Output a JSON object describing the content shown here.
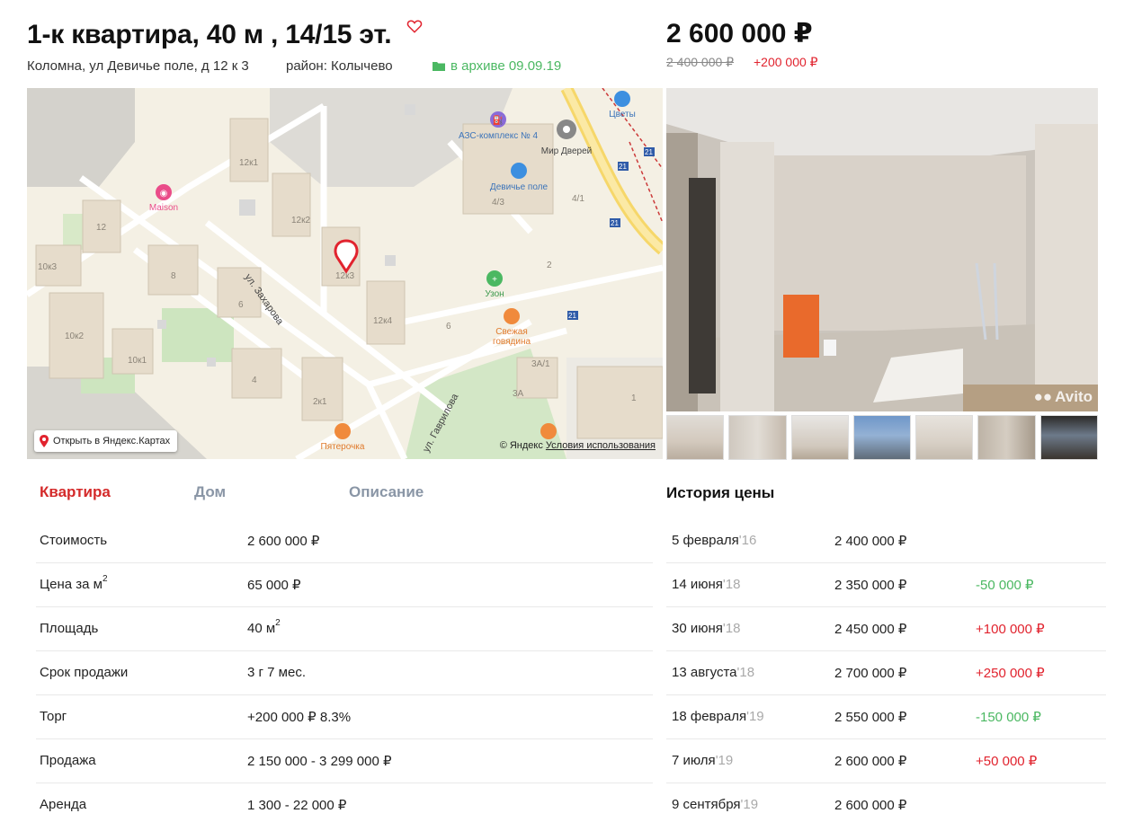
{
  "listing": {
    "title": "1-к квартира, 40 м , 14/15 эт.",
    "address": "Коломна, ул Девичье поле, д 12 к 3",
    "district": "район: Колычево",
    "archive_label": "в архиве 09.09.19",
    "favorite_icon": "heart-icon",
    "price": "2 600 000 ₽",
    "old_price": "2 400 000 ₽",
    "price_change": "+200 000 ₽"
  },
  "map": {
    "open_link": "Открыть в Яндекс.Картах",
    "copyright": "© Яндекс",
    "terms": "Условия использования",
    "street1": "ул. Захарова",
    "street2": "ул. Гаврилова",
    "poi_maison": "Maison",
    "poi_azs": "АЗС-комплекс № 4",
    "poi_doors": "Мир Дверей",
    "poi_flowers": "Цветы",
    "poi_field": "Девичье поле",
    "poi_uzon": "Узон",
    "poi_meat1": "Свежая",
    "poi_meat2": "говядина",
    "poi_pyat": "Пятерочка",
    "b_12k1": "12к1",
    "b_12k2": "12к2",
    "b_12": "12",
    "b_10k3": "10к3",
    "b_8": "8",
    "b_6": "6",
    "b_10k2": "10к2",
    "b_10k1": "10к1",
    "b_4": "4",
    "b_2k1": "2к1",
    "b_12k3": "12к3",
    "b_12k4": "12к4",
    "b_4_3": "4/3",
    "b_4_1": "4/1",
    "b_2": "2",
    "b_6b": "6",
    "b_3a1": "3А/1",
    "b_3a": "3А",
    "b_1": "1",
    "route": "21"
  },
  "photo": {
    "watermark": "Avito",
    "thumb_count": 7
  },
  "tabs": [
    {
      "label": "Квартира",
      "active": true
    },
    {
      "label": "Дом",
      "active": false
    },
    {
      "label": "Описание",
      "active": false
    }
  ],
  "properties": [
    {
      "label": "Стоимость",
      "value": "2 600 000 ₽"
    },
    {
      "label": "Цена за м",
      "label_sup": "2",
      "value": "65 000 ₽"
    },
    {
      "label": "Площадь",
      "value": "40 м",
      "value_sup": "2"
    },
    {
      "label": "Срок продажи",
      "value": "3 г 7 мес."
    },
    {
      "label": "Торг",
      "value": "+200 000  ₽  8.3%"
    },
    {
      "label": "Продажа",
      "value": "2 150 000 - 3 299 000  ₽"
    },
    {
      "label": "Аренда",
      "value": "1 300 - 22 000  ₽"
    }
  ],
  "history": {
    "title": "История цены",
    "rows": [
      {
        "date": "5 февраля",
        "year": "'16",
        "price": "2 400 000  ₽",
        "delta": "",
        "delta_sign": ""
      },
      {
        "date": "14 июня",
        "year": "'18",
        "price": "2 350 000  ₽",
        "delta": "-50 000  ₽",
        "delta_sign": "neg"
      },
      {
        "date": "30 июня",
        "year": "'18",
        "price": "2 450 000  ₽",
        "delta": "+100 000  ₽",
        "delta_sign": "pos"
      },
      {
        "date": "13 августа",
        "year": "'18",
        "price": "2 700 000  ₽",
        "delta": "+250 000  ₽",
        "delta_sign": "pos"
      },
      {
        "date": "18 февраля",
        "year": "'19",
        "price": "2 550 000  ₽",
        "delta": "-150 000  ₽",
        "delta_sign": "neg"
      },
      {
        "date": "7 июля",
        "year": "'19",
        "price": "2 600 000  ₽",
        "delta": "+50 000  ₽",
        "delta_sign": "pos"
      },
      {
        "date": "9 сентября",
        "year": "'19",
        "price": "2 600 000  ₽",
        "delta": "",
        "delta_sign": ""
      }
    ]
  },
  "colors": {
    "accent_red": "#d42a2a",
    "green": "#4bb862",
    "tab_inactive": "#8a96a6"
  }
}
